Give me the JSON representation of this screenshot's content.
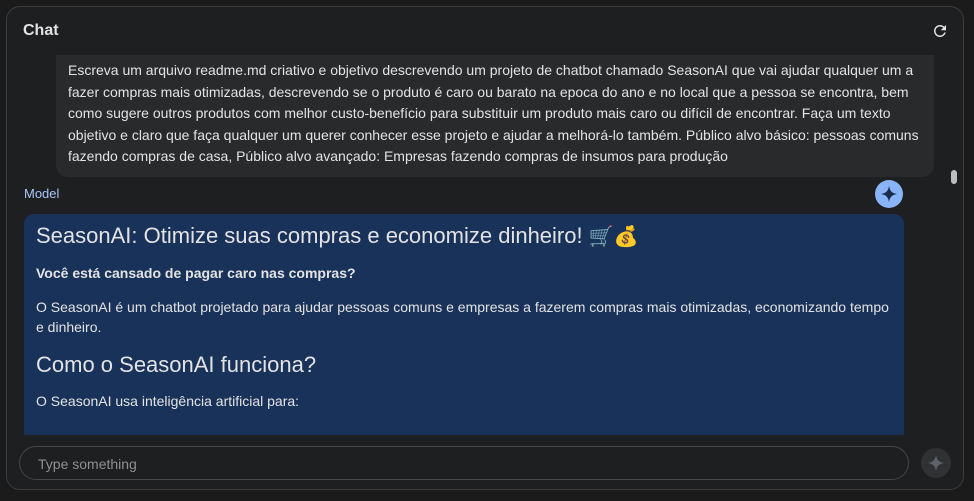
{
  "header": {
    "title": "Chat"
  },
  "user_message": {
    "text": "Escreva um arquivo readme.md criativo e objetivo descrevendo um projeto de chatbot chamado SeasonAI que vai ajudar qualquer um a fazer compras mais otimizadas, descrevendo se o produto é caro ou barato na epoca do ano e no local que a pessoa se encontra, bem como sugere outros produtos com melhor custo-benefício para substituir um produto mais caro ou difícil de encontrar. Faça um texto objetivo e claro que faça qualquer um querer conhecer esse projeto e ajudar a melhorá-lo também. Público alvo básico: pessoas comuns fazendo compras de casa, Público alvo avançado: Empresas fazendo compras de insumos para produção"
  },
  "model": {
    "label": "Model",
    "heading": "SeasonAI: Otimize suas compras e economize dinheiro!",
    "heading_emojis": "🛒💰",
    "question": "Você está cansado de pagar caro nas compras?",
    "intro": "O SeasonAI é um chatbot projetado para ajudar pessoas comuns e empresas a fazerem compras mais otimizadas, economizando tempo e dinheiro.",
    "subheading": "Como o SeasonAI funciona?",
    "uses": "O SeasonAI usa inteligência artificial para:"
  },
  "input": {
    "placeholder": "Type something"
  },
  "icons": {
    "refresh": "refresh-icon",
    "model_avatar": "sparkle-icon",
    "send": "sparkle-send-icon"
  },
  "colors": {
    "background": "#1e1f20",
    "user_bubble": "#282a2c",
    "model_bubble": "#19325a",
    "accent": "#8ab4f8",
    "model_label": "#a8c7fa"
  }
}
